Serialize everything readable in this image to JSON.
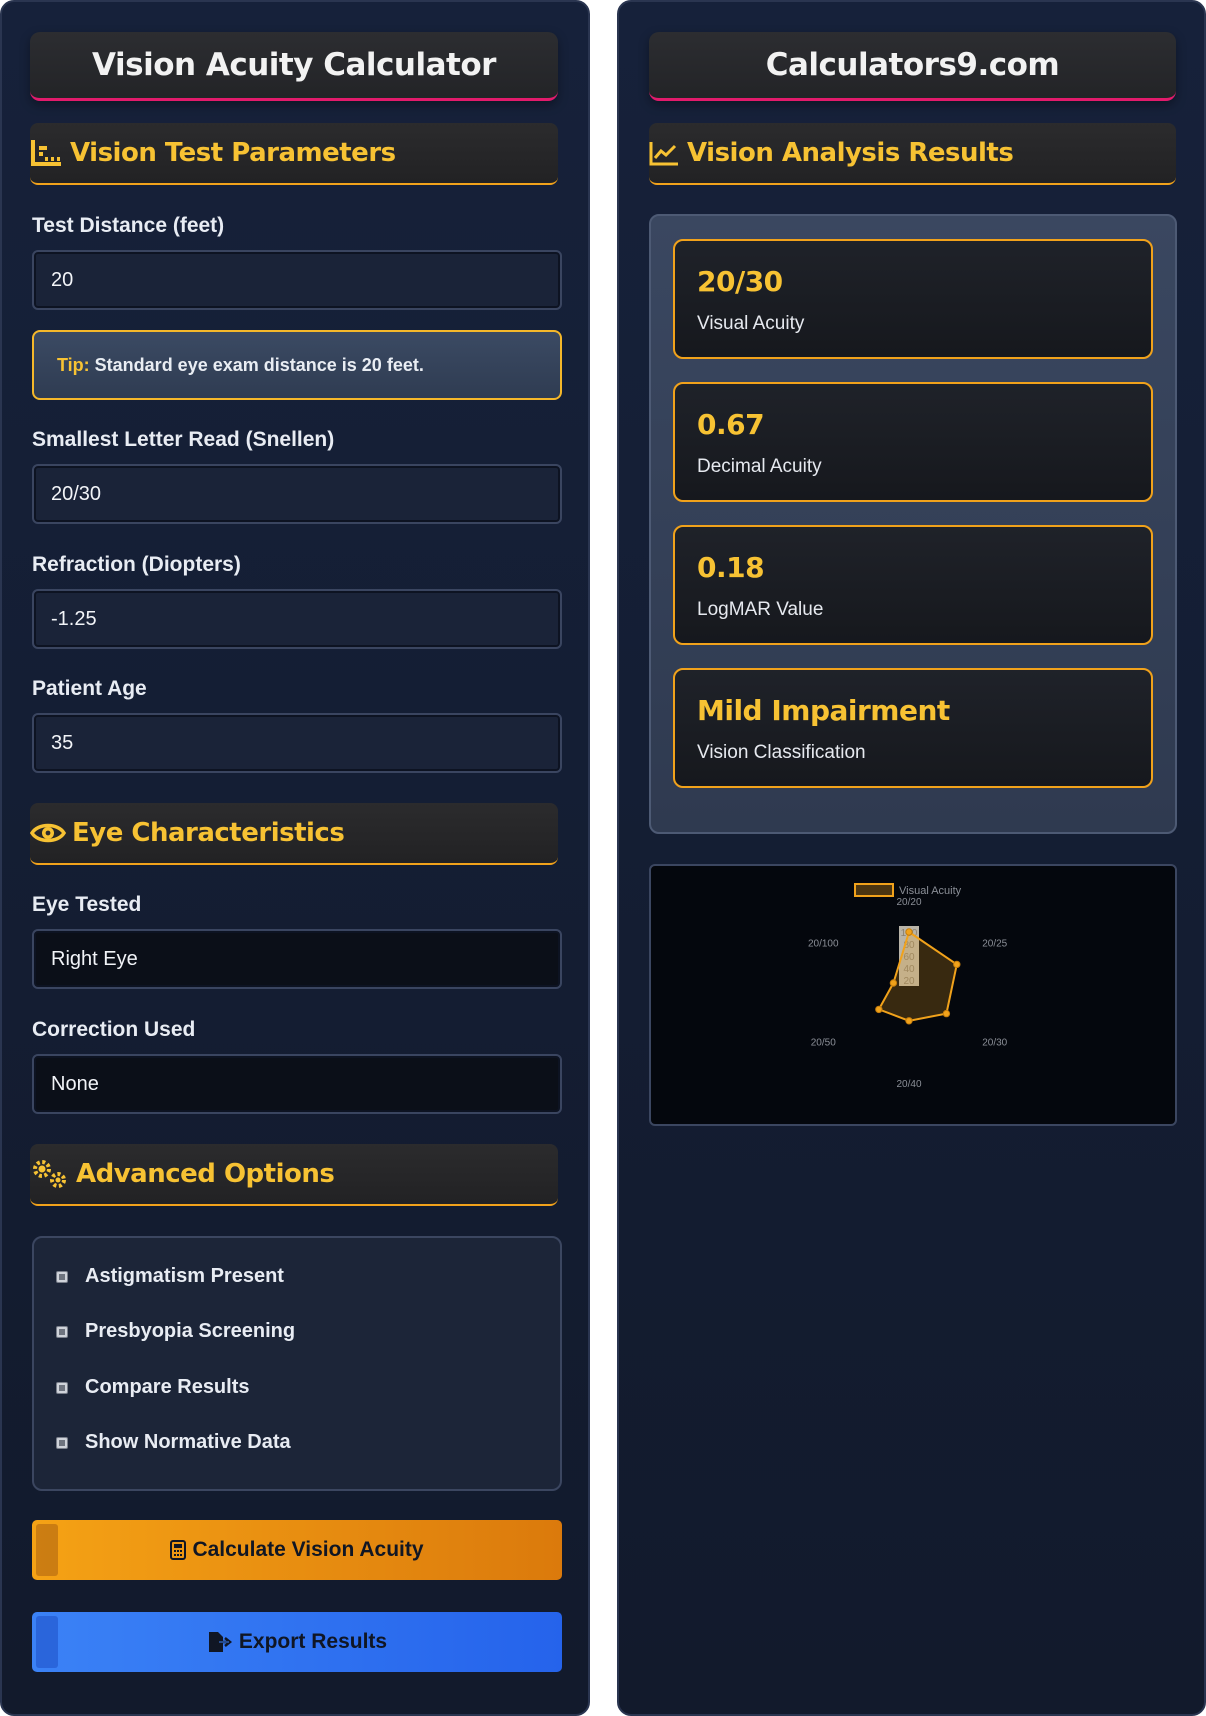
{
  "left": {
    "title": "Vision Acuity Calculator",
    "sections": {
      "params": "Vision Test Parameters",
      "eye": "Eye Characteristics",
      "advanced": "Advanced Options"
    },
    "fields": {
      "distance": {
        "label": "Test Distance (feet)",
        "value": "20"
      },
      "tip": {
        "key": "Tip:",
        "text": "Standard eye exam distance is 20 feet."
      },
      "snellen": {
        "label": "Smallest Letter Read (Snellen)",
        "value": "20/30"
      },
      "refraction": {
        "label": "Refraction (Diopters)",
        "value": "-1.25"
      },
      "age": {
        "label": "Patient Age",
        "value": "35"
      },
      "eye_tested": {
        "label": "Eye Tested",
        "value": "Right Eye"
      },
      "correction": {
        "label": "Correction Used",
        "value": "None"
      }
    },
    "options": [
      "Astigmatism Present",
      "Presbyopia Screening",
      "Compare Results",
      "Show Normative Data"
    ],
    "buttons": {
      "calculate": "Calculate Vision Acuity",
      "export": "Export Results"
    }
  },
  "right": {
    "title": "Calculators9.com",
    "section": "Vision Analysis Results",
    "results": [
      {
        "value": "20/30",
        "label": "Visual Acuity"
      },
      {
        "value": "0.67",
        "label": "Decimal Acuity"
      },
      {
        "value": "0.18",
        "label": "LogMAR Value"
      },
      {
        "value": "Mild Impairment",
        "label": "Vision Classification"
      }
    ]
  },
  "colors": {
    "accent": "#f7c233",
    "title_underline": "#e21b6c",
    "section_underline": "#f1a21b",
    "calc_button": "#f5a215",
    "export_button": "#3b82f6",
    "panel_bg": "#16213a"
  },
  "icons": {
    "params": "ruler-chart-icon",
    "results": "line-chart-icon",
    "eye": "eye-icon",
    "advanced": "gears-icon",
    "calculate": "calculator-icon",
    "export": "export-file-icon"
  },
  "chart_data": {
    "type": "radar",
    "legend": "Visual Acuity",
    "categories": [
      "20/20",
      "20/25",
      "20/30",
      "20/40",
      "20/50",
      "20/100"
    ],
    "ticks": [
      "100",
      "80",
      "60",
      "40",
      "20"
    ],
    "r_range": [
      0,
      100
    ],
    "values": [
      100,
      92,
      72,
      48,
      58,
      30
    ]
  }
}
